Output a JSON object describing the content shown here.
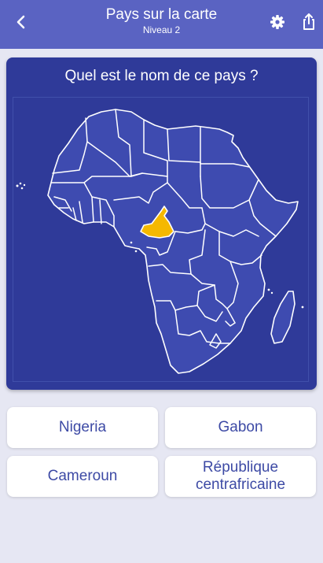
{
  "header": {
    "title": "Pays sur la carte",
    "subtitle": "Niveau 2",
    "back_icon": "chevron-left-icon",
    "settings_icon": "gear-icon",
    "share_icon": "share-icon"
  },
  "question": "Quel est le nom de ce pays ?",
  "map": {
    "highlighted_country": "Cameroun",
    "colors": {
      "land": "#3e4bb0",
      "borders": "#ffffff",
      "highlight": "#f5b800",
      "card": "#2f3a99"
    }
  },
  "answers": [
    {
      "label": "Nigeria"
    },
    {
      "label": "Gabon"
    },
    {
      "label": "Cameroun"
    },
    {
      "label": "République centrafricaine"
    }
  ],
  "colors": {
    "header": "#5a63c2",
    "background": "#e6e7f3",
    "answer_text": "#3d4aa5"
  }
}
